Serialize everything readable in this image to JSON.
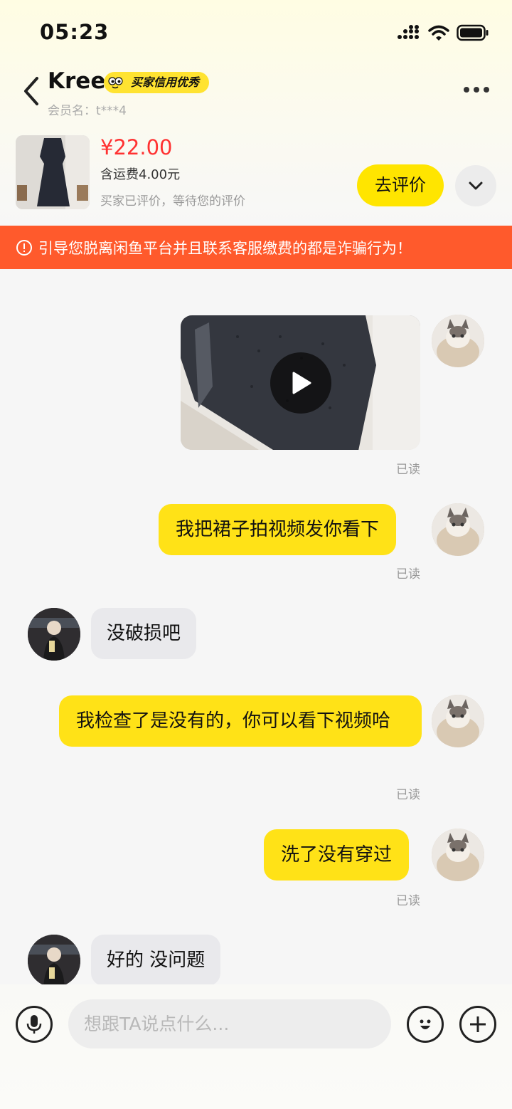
{
  "status_bar": {
    "time": "05:23",
    "icons": [
      "cellular-signal-icon",
      "wifi-icon",
      "battery-icon"
    ]
  },
  "header": {
    "name": "Kree",
    "credit_badge": "买家信用优秀",
    "member_label": "会员名：t***4",
    "icons": [
      "back-chevron-icon",
      "more-dots-icon"
    ]
  },
  "order": {
    "price": "¥22.00",
    "shipping": "含运费4.00元",
    "status": "买家已评价，等待您的评价",
    "review_button": "去评价",
    "expand_icon": "chevron-down-icon"
  },
  "warning": {
    "text": "引导您脱离闲鱼平台并且联系客服缴费的都是诈骗行为！",
    "icon": "alert-circle-icon"
  },
  "messages": [
    {
      "from": "me",
      "type": "video",
      "read": "已读"
    },
    {
      "from": "me",
      "type": "text",
      "text": "我把裙子拍视频发你看下",
      "read": "已读"
    },
    {
      "from": "other",
      "type": "text",
      "text": "没破损吧"
    },
    {
      "from": "me",
      "type": "text",
      "text": "我检查了是没有的，你可以看下视频哈",
      "read": "已读"
    },
    {
      "from": "me",
      "type": "text",
      "text": "洗了没有穿过",
      "read": "已读"
    },
    {
      "from": "other",
      "type": "text",
      "text": "好的 没问题"
    }
  ],
  "input_bar": {
    "placeholder": "想跟TA说点什么...",
    "value": "",
    "icons": [
      "microphone-icon",
      "emoji-icon",
      "plus-icon"
    ]
  },
  "colors": {
    "accent_yellow": "#ffe217",
    "price_red": "#ff3232",
    "warning_orange": "#ff5a2c",
    "other_bubble": "#e9e9ec"
  }
}
